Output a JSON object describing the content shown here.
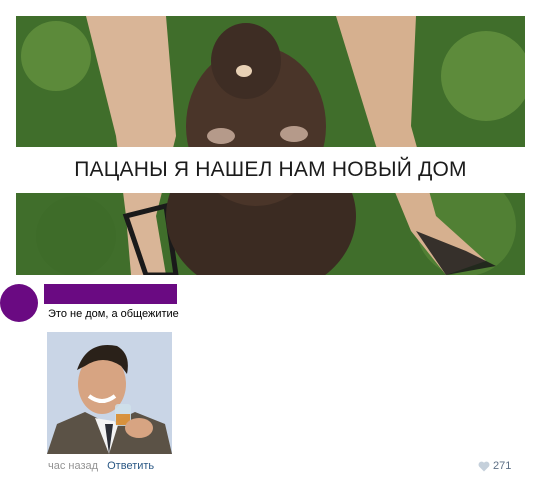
{
  "post": {
    "meme_caption": "ПАЦАНЫ Я НАШЕЛ НАМ НОВЫЙ ДОМ"
  },
  "comment": {
    "text": "Это не дом, а общежитие",
    "time": "час назад",
    "reply_label": "Ответить",
    "likes": "271",
    "author_redaction_color": "#6a0a82"
  },
  "icons": {
    "like": "heart-icon"
  }
}
